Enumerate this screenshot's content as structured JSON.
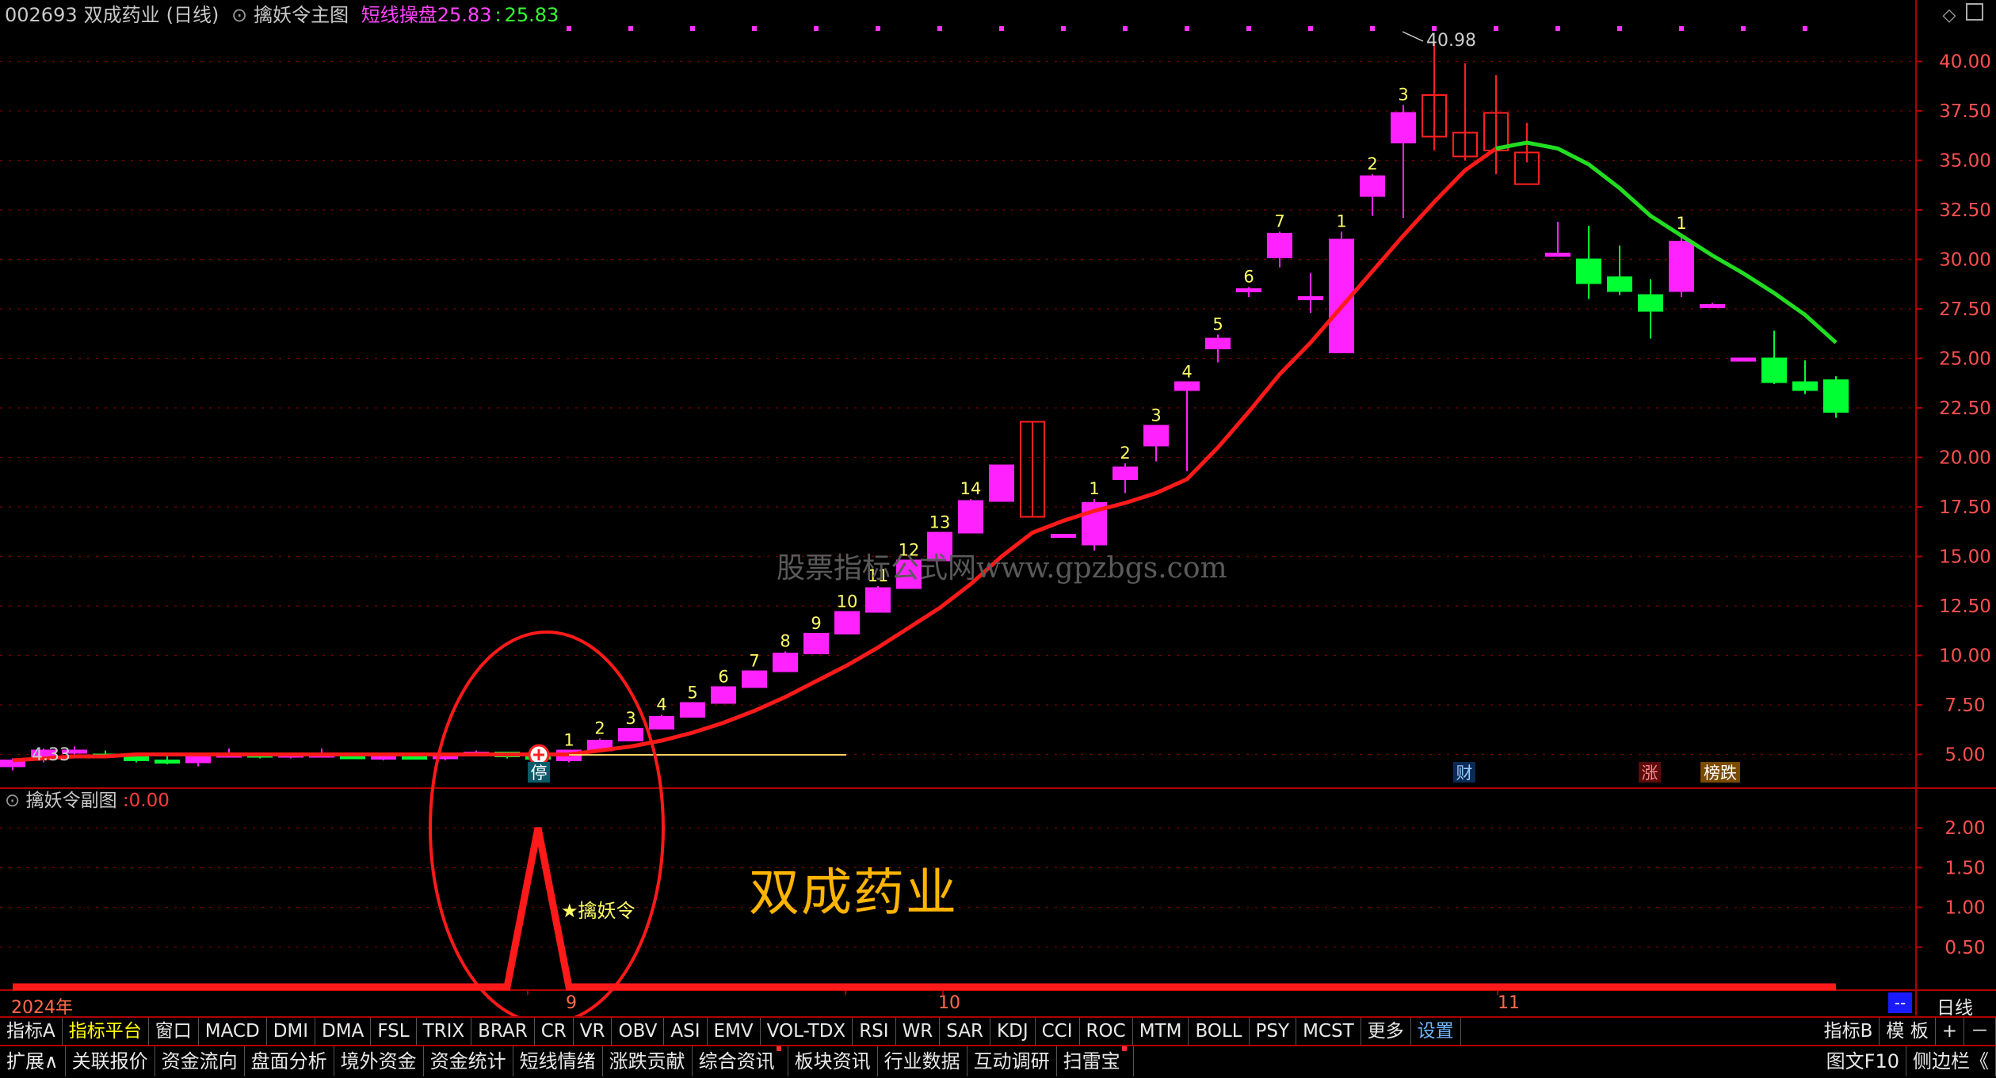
{
  "header": {
    "code": "002693",
    "name": "双成药业",
    "period": "(日线)",
    "indicator_name": "擒妖令主图",
    "line_label": "短线操盘",
    "line_value_a": "25.83",
    "line_value_b": "25.83"
  },
  "sub_header": {
    "indicator_name": "擒妖令副图",
    "value": "0.00"
  },
  "overlay_text": {
    "stock_name": "双成药业",
    "watermark": "股票指标公式网www.gpzbgs.com",
    "signal_label": "★擒妖令",
    "high_label": "40.98",
    "low_label": "4.33",
    "stop_label": "停",
    "cai_label": "财",
    "zhang_label": "涨",
    "bang_label": "榜跌"
  },
  "price_axis": [
    "40.00",
    "37.50",
    "35.00",
    "32.50",
    "30.00",
    "27.50",
    "25.00",
    "22.50",
    "20.00",
    "17.50",
    "15.00",
    "12.50",
    "10.00",
    "7.50",
    "5.00"
  ],
  "sub_axis": [
    "2.00",
    "1.50",
    "1.00",
    "0.50"
  ],
  "date_axis": [
    {
      "label": "2024年"
    },
    {
      "label": "9"
    },
    {
      "label": "10"
    },
    {
      "label": "11"
    }
  ],
  "date_axis_extra": {
    "dash": "--",
    "period_button": "日线"
  },
  "colors": {
    "up": "#ff22ff",
    "down": "#00ff33",
    "ma_up": "#ff1a1a",
    "ma_down": "#22dd22",
    "axis": "#b00000",
    "grid": "#7a0000"
  },
  "chart_data": {
    "type": "candlestick",
    "ylim": [
      3.5,
      41.5
    ],
    "candles": [
      {
        "o": 4.4,
        "h": 4.8,
        "l": 4.2,
        "c": 4.7
      },
      {
        "o": 4.8,
        "h": 5.3,
        "l": 4.6,
        "c": 5.2
      },
      {
        "o": 5.1,
        "h": 5.4,
        "l": 4.9,
        "c": 5.2
      },
      {
        "o": 5.0,
        "h": 5.2,
        "l": 4.8,
        "c": 4.9
      },
      {
        "o": 4.9,
        "h": 5.0,
        "l": 4.6,
        "c": 4.7
      },
      {
        "o": 4.7,
        "h": 4.9,
        "l": 4.5,
        "c": 4.6
      },
      {
        "o": 4.6,
        "h": 5.1,
        "l": 4.4,
        "c": 5.0
      },
      {
        "o": 5.0,
        "h": 5.3,
        "l": 4.9,
        "c": 5.0
      },
      {
        "o": 5.0,
        "h": 5.1,
        "l": 4.8,
        "c": 4.9
      },
      {
        "o": 4.9,
        "h": 5.0,
        "l": 4.8,
        "c": 5.0
      },
      {
        "o": 5.0,
        "h": 5.3,
        "l": 4.9,
        "c": 5.0
      },
      {
        "o": 5.0,
        "h": 5.1,
        "l": 4.8,
        "c": 4.8
      },
      {
        "o": 4.8,
        "h": 5.0,
        "l": 4.7,
        "c": 4.9
      },
      {
        "o": 4.9,
        "h": 5.0,
        "l": 4.8,
        "c": 4.8
      },
      {
        "o": 4.8,
        "h": 5.1,
        "l": 4.7,
        "c": 5.0
      },
      {
        "o": 5.0,
        "h": 5.2,
        "l": 4.9,
        "c": 5.1
      },
      {
        "o": 5.1,
        "h": 5.1,
        "l": 4.8,
        "c": 4.9
      },
      {
        "o": 4.9,
        "h": 5.0,
        "l": 4.7,
        "c": 4.8
      },
      {
        "o": 4.7,
        "h": 5.2,
        "l": 4.6,
        "c": 5.2
      },
      {
        "o": 5.2,
        "h": 5.8,
        "l": 5.2,
        "c": 5.7
      },
      {
        "o": 5.7,
        "h": 6.3,
        "l": 5.7,
        "c": 6.3
      },
      {
        "o": 6.3,
        "h": 7.0,
        "l": 6.3,
        "c": 6.9
      },
      {
        "o": 6.9,
        "h": 7.6,
        "l": 6.9,
        "c": 7.6
      },
      {
        "o": 7.6,
        "h": 8.4,
        "l": 7.6,
        "c": 8.4
      },
      {
        "o": 8.4,
        "h": 9.2,
        "l": 8.4,
        "c": 9.2
      },
      {
        "o": 9.2,
        "h": 10.2,
        "l": 9.2,
        "c": 10.1
      },
      {
        "o": 10.1,
        "h": 11.1,
        "l": 10.1,
        "c": 11.1
      },
      {
        "o": 11.1,
        "h": 12.2,
        "l": 11.1,
        "c": 12.2
      },
      {
        "o": 12.2,
        "h": 13.5,
        "l": 12.2,
        "c": 13.4
      },
      {
        "o": 13.4,
        "h": 14.8,
        "l": 13.4,
        "c": 14.8
      },
      {
        "o": 14.8,
        "h": 16.2,
        "l": 14.8,
        "c": 16.2
      },
      {
        "o": 16.2,
        "h": 17.9,
        "l": 16.2,
        "c": 17.8
      },
      {
        "o": 17.8,
        "h": 19.6,
        "l": 17.8,
        "c": 19.6
      },
      {
        "o": 21.8,
        "h": 21.8,
        "l": 17.0,
        "c": 17.0
      },
      {
        "o": 16.1,
        "h": 16.1,
        "l": 16.1,
        "c": 16.1
      },
      {
        "o": 15.6,
        "h": 17.9,
        "l": 15.3,
        "c": 17.7
      },
      {
        "o": 18.9,
        "h": 19.7,
        "l": 18.2,
        "c": 19.5
      },
      {
        "o": 20.6,
        "h": 21.6,
        "l": 19.8,
        "c": 21.6
      },
      {
        "o": 23.4,
        "h": 23.8,
        "l": 19.3,
        "c": 23.8
      },
      {
        "o": 25.5,
        "h": 26.2,
        "l": 24.8,
        "c": 26.0
      },
      {
        "o": 28.4,
        "h": 28.6,
        "l": 28.1,
        "c": 28.5
      },
      {
        "o": 30.1,
        "h": 31.4,
        "l": 29.6,
        "c": 31.3
      },
      {
        "o": 28.1,
        "h": 29.3,
        "l": 27.3,
        "c": 28.1
      },
      {
        "o": 25.3,
        "h": 31.4,
        "l": 25.3,
        "c": 31.0
      },
      {
        "o": 33.2,
        "h": 34.3,
        "l": 32.2,
        "c": 34.2
      },
      {
        "o": 35.9,
        "h": 37.8,
        "l": 32.1,
        "c": 37.4
      },
      {
        "o": 36.2,
        "h": 40.9,
        "l": 35.5,
        "c": 38.3
      },
      {
        "o": 35.2,
        "h": 39.9,
        "l": 35.0,
        "c": 36.4
      },
      {
        "o": 35.5,
        "h": 39.3,
        "l": 34.3,
        "c": 37.4
      },
      {
        "o": 35.4,
        "h": 36.9,
        "l": 34.9,
        "c": 33.8
      },
      {
        "o": 30.3,
        "h": 31.9,
        "l": 30.3,
        "c": 30.3
      },
      {
        "o": 30.0,
        "h": 31.7,
        "l": 28.0,
        "c": 28.8
      },
      {
        "o": 29.1,
        "h": 30.7,
        "l": 28.2,
        "c": 28.4
      },
      {
        "o": 28.2,
        "h": 29.0,
        "l": 26.0,
        "c": 27.4
      },
      {
        "o": 28.4,
        "h": 31.3,
        "l": 28.1,
        "c": 30.9
      },
      {
        "o": 27.7,
        "h": 27.8,
        "l": 27.7,
        "c": 27.7
      },
      {
        "o": 25.0,
        "h": 25.0,
        "l": 25.0,
        "c": 25.0
      },
      {
        "o": 25.0,
        "h": 26.4,
        "l": 23.7,
        "c": 23.8
      },
      {
        "o": 23.8,
        "h": 24.9,
        "l": 23.2,
        "c": 23.4
      },
      {
        "o": 23.9,
        "h": 24.1,
        "l": 22.0,
        "c": 22.3
      }
    ],
    "labels": [
      {
        "i": 18,
        "t": "1"
      },
      {
        "i": 19,
        "t": "2"
      },
      {
        "i": 20,
        "t": "3"
      },
      {
        "i": 21,
        "t": "4"
      },
      {
        "i": 22,
        "t": "5"
      },
      {
        "i": 23,
        "t": "6"
      },
      {
        "i": 24,
        "t": "7"
      },
      {
        "i": 25,
        "t": "8"
      },
      {
        "i": 26,
        "t": "9"
      },
      {
        "i": 27,
        "t": "10"
      },
      {
        "i": 28,
        "t": "11"
      },
      {
        "i": 29,
        "t": "12"
      },
      {
        "i": 30,
        "t": "13"
      },
      {
        "i": 31,
        "t": "14"
      },
      {
        "i": 35,
        "t": "1"
      },
      {
        "i": 36,
        "t": "2"
      },
      {
        "i": 37,
        "t": "3"
      },
      {
        "i": 38,
        "t": "4"
      },
      {
        "i": 39,
        "t": "5"
      },
      {
        "i": 40,
        "t": "6"
      },
      {
        "i": 41,
        "t": "7"
      },
      {
        "i": 43,
        "t": "1"
      },
      {
        "i": 44,
        "t": "2"
      },
      {
        "i": 45,
        "t": "3"
      },
      {
        "i": 54,
        "t": "1"
      }
    ],
    "ma": [
      4.7,
      4.8,
      4.9,
      4.9,
      5.0,
      5.0,
      5.0,
      5.0,
      5.0,
      5.0,
      5.0,
      5.0,
      5.0,
      5.0,
      5.0,
      5.0,
      5.0,
      5.0,
      5.0,
      5.2,
      5.4,
      5.7,
      6.1,
      6.6,
      7.2,
      7.9,
      8.7,
      9.5,
      10.4,
      11.4,
      12.4,
      13.6,
      15.0,
      16.2,
      16.8,
      17.3,
      17.7,
      18.2,
      18.9,
      20.5,
      22.3,
      24.2,
      25.8,
      27.6,
      29.4,
      31.2,
      32.9,
      34.5,
      35.6,
      35.9,
      35.6,
      34.8,
      33.6,
      32.2,
      31.2,
      30.2,
      29.3,
      28.3,
      27.2,
      25.8
    ],
    "sub": {
      "type": "line",
      "values": [
        0,
        0,
        0,
        0,
        0,
        0,
        0,
        0,
        0,
        0,
        0,
        0,
        0,
        0,
        0,
        0,
        0,
        2,
        0,
        0,
        0,
        0,
        0,
        0,
        0,
        0,
        0,
        0,
        0,
        0,
        0,
        0,
        0,
        0,
        0,
        0,
        0,
        0,
        0,
        0,
        0,
        0,
        0,
        0,
        0,
        0,
        0,
        0,
        0,
        0,
        0,
        0,
        0,
        0,
        0,
        0,
        0,
        0,
        0,
        0
      ],
      "ylim": [
        0,
        2.3
      ]
    }
  },
  "toolbar1": {
    "items": [
      "指标A",
      "指标平台",
      "窗口",
      "MACD",
      "DMI",
      "DMA",
      "FSL",
      "TRIX",
      "BRAR",
      "CR",
      "VR",
      "OBV",
      "ASI",
      "EMV",
      "VOL-TDX",
      "RSI",
      "WR",
      "SAR",
      "KDJ",
      "CCI",
      "ROC",
      "MTM",
      "BOLL",
      "PSY",
      "MCST",
      "更多",
      "设置"
    ],
    "right": [
      "指标B",
      "模 板",
      "+",
      "－"
    ]
  },
  "toolbar2": {
    "items": [
      "扩展∧",
      "关联报价",
      "资金流向",
      "盘面分析",
      "境外资金",
      "资金统计",
      "短线情绪",
      "涨跌贡献",
      "综合资讯",
      "板块资讯",
      "行业数据",
      "互动调研",
      "扫雷宝"
    ],
    "right": [
      "图文F10",
      "侧边栏《"
    ]
  }
}
